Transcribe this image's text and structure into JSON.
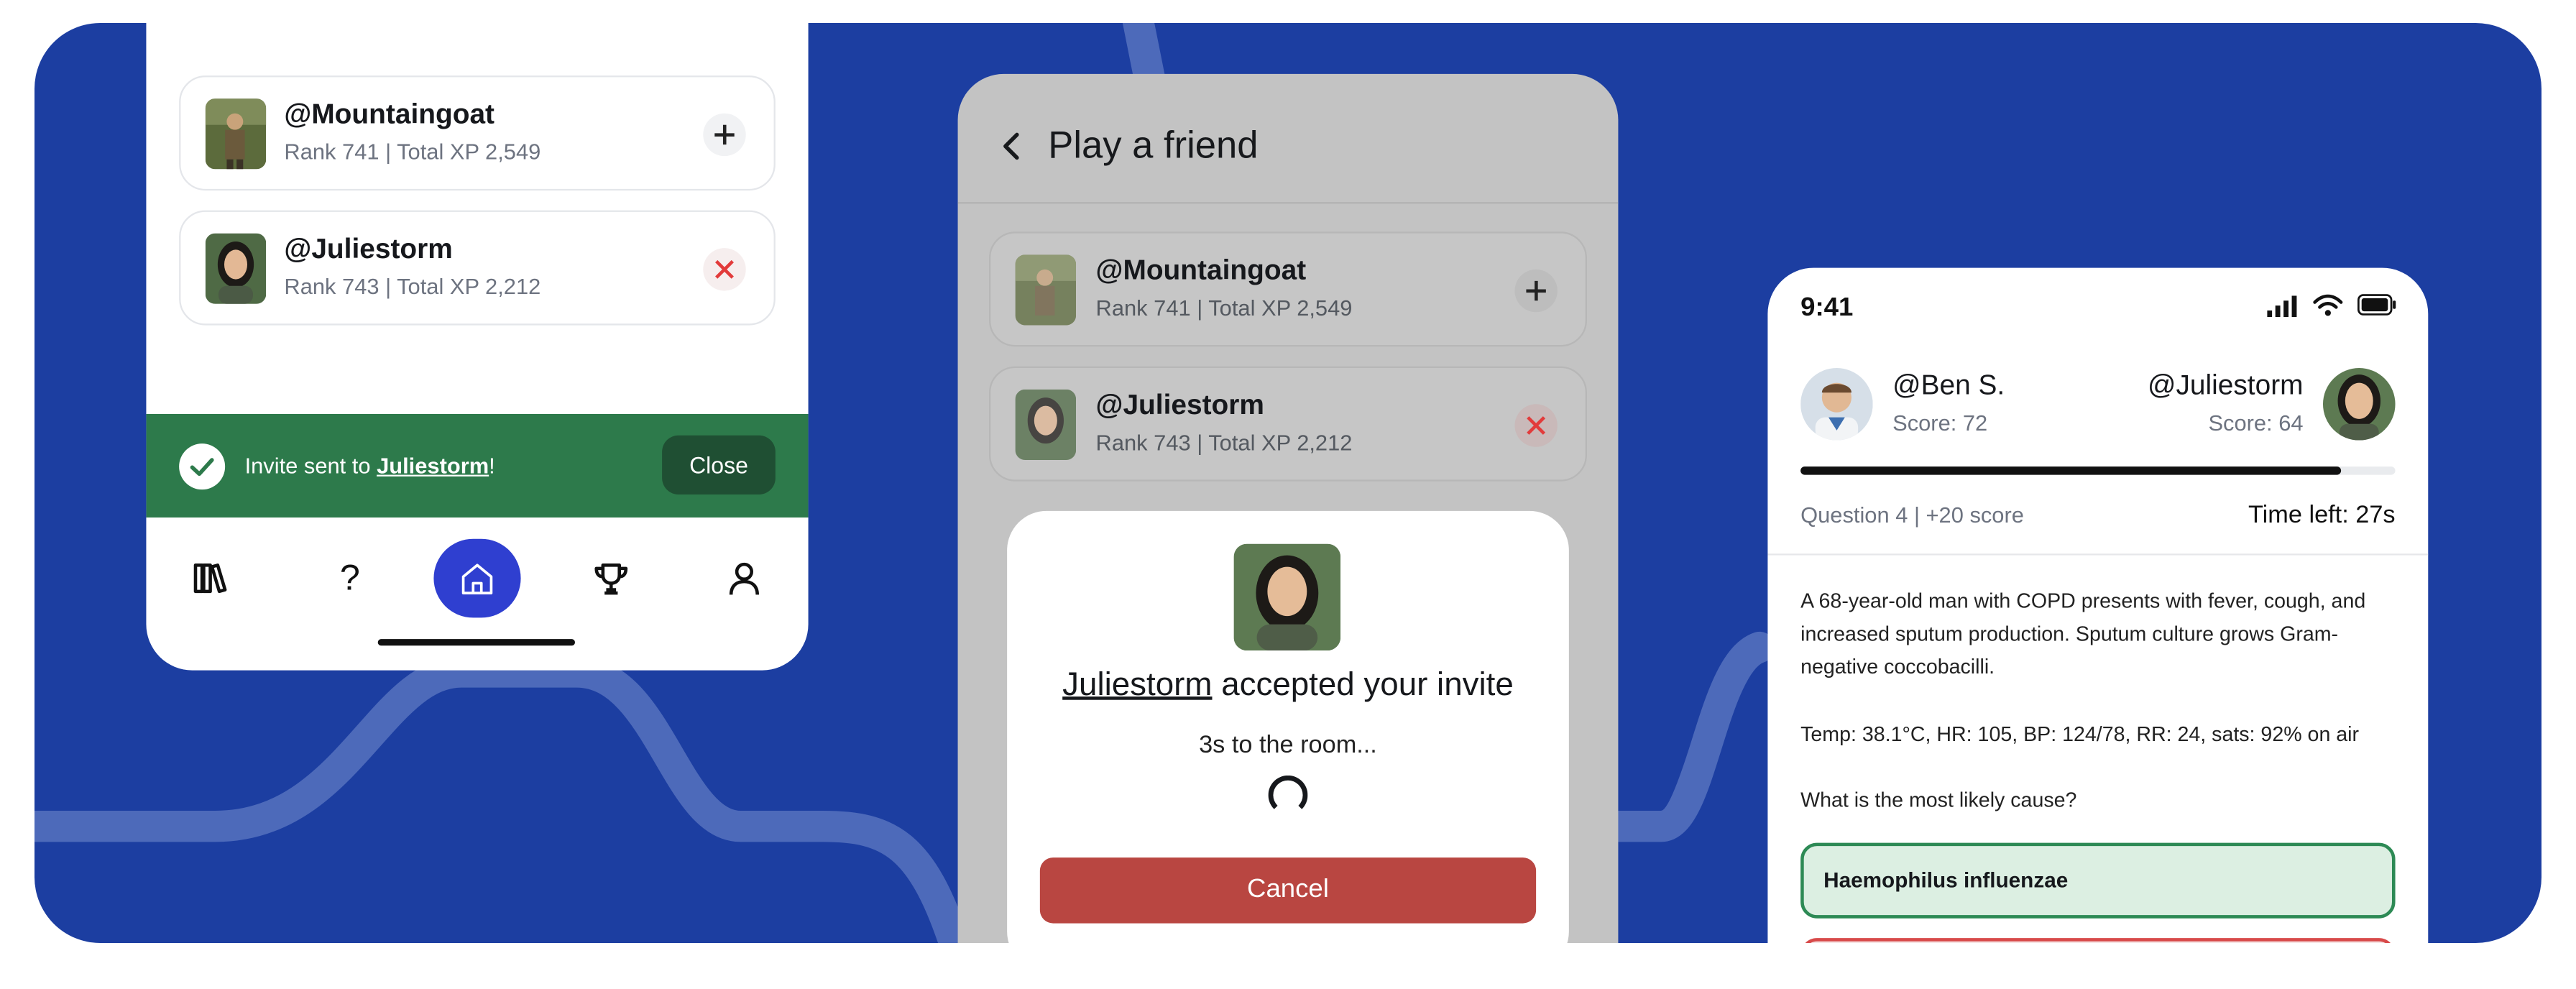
{
  "colors": {
    "banner": "#1c3ea1",
    "toast": "#2d7a4b",
    "home_button": "#2f3fd0",
    "cancel": "#b94641",
    "correct": "#2d8a55"
  },
  "friends_list": {
    "items": [
      {
        "handle": "@Mountaingoat",
        "meta": "Rank 741 | Total XP 2,549",
        "action": "plus-icon"
      },
      {
        "handle": "@Juliestorm",
        "meta": "Rank 743 | Total XP 2,212",
        "action": "close-icon"
      }
    ]
  },
  "toast": {
    "prefix": "Invite sent to ",
    "name": "Juliestorm",
    "suffix": "!",
    "close_label": "Close"
  },
  "bottom_nav": {
    "icons": [
      "library-icon",
      "question-icon",
      "home-icon",
      "trophy-icon",
      "profile-icon"
    ],
    "question_glyph": "?"
  },
  "play_friend": {
    "title": "Play a friend",
    "items": [
      {
        "handle": "@Mountaingoat",
        "meta": "Rank 741 | Total XP 2,549"
      },
      {
        "handle": "@Juliestorm",
        "meta": "Rank 743 | Total XP 2,212"
      }
    ],
    "modal": {
      "name": "Juliestorm",
      "title_rest": " accepted your invite",
      "countdown": "3s to the room...",
      "cancel_label": "Cancel"
    }
  },
  "quiz": {
    "status_time": "9:41",
    "player1": {
      "name": "@Ben S.",
      "score": "Score: 72"
    },
    "player2": {
      "name": "@Juliestorm",
      "score": "Score: 64"
    },
    "progress": 0.91,
    "question_info": "Question 4 | +20 score",
    "time_left": "Time left: 27s",
    "stem": "A 68-year-old man with COPD presents with fever, cough, and increased sputum production. Sputum culture grows Gram-negative coccobacilli.",
    "vitals": "Temp: 38.1°C, HR: 105, BP: 124/78, RR: 24, sats: 92% on air",
    "prompt": "What is the most likely cause?",
    "options": [
      "Haemophilus influenzae",
      ""
    ]
  }
}
